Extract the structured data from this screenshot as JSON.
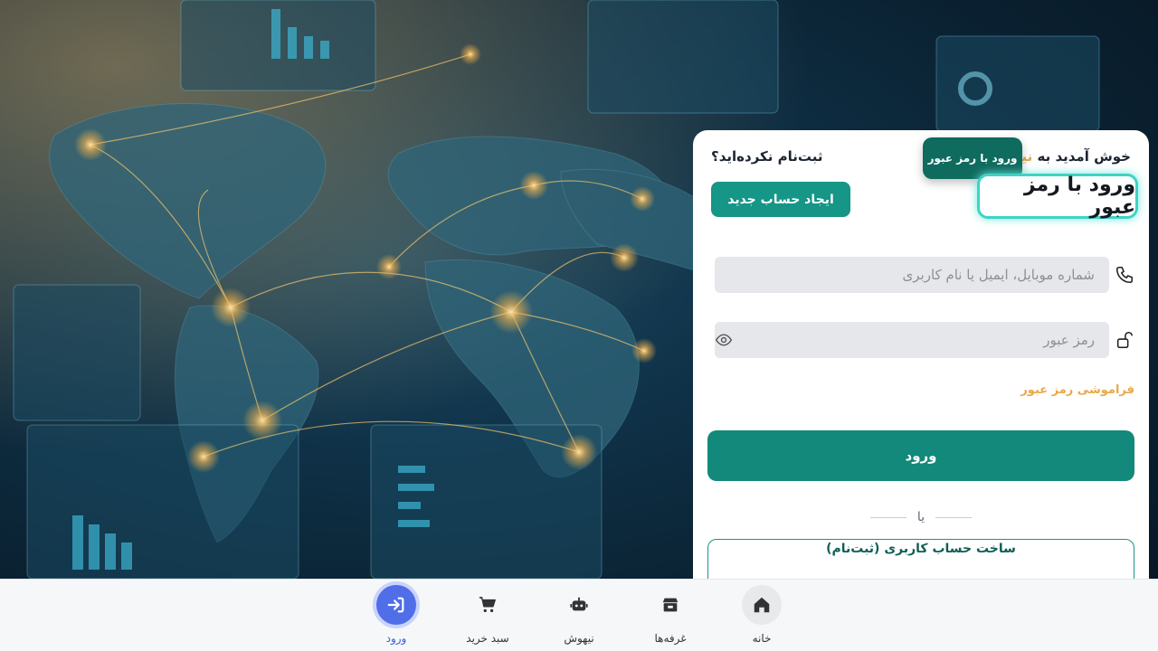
{
  "panel": {
    "welcome_prefix": "خوش آمدید به",
    "brand": "نیبرو",
    "login_chip": "ورود با رمز عبور",
    "title": "ورود با رمز عبور",
    "no_account": "ثبت‌نام نکرده‌اید؟",
    "create_account": "ایجاد حساب جدید",
    "username_placeholder": "شماره موبایل، ایمیل یا نام کاربری",
    "password_placeholder": "رمز عبور",
    "forgot": "فراموشی رمز عبور",
    "submit": "ورود",
    "or": "یا",
    "signup": "ساخت حساب کاربری (ثبت‌نام)"
  },
  "nav": {
    "items": [
      {
        "label": "ورود",
        "icon": "login-icon",
        "active": true
      },
      {
        "label": "سبد خرید",
        "icon": "cart-icon"
      },
      {
        "label": "نیهوش",
        "icon": "robot-icon"
      },
      {
        "label": "غرفه‌ها",
        "icon": "store-icon"
      },
      {
        "label": "خانه",
        "icon": "home-icon"
      }
    ]
  },
  "colors": {
    "primary": "#12897a",
    "accent": "#e8a94a",
    "nav_active": "#4f6ee8"
  }
}
